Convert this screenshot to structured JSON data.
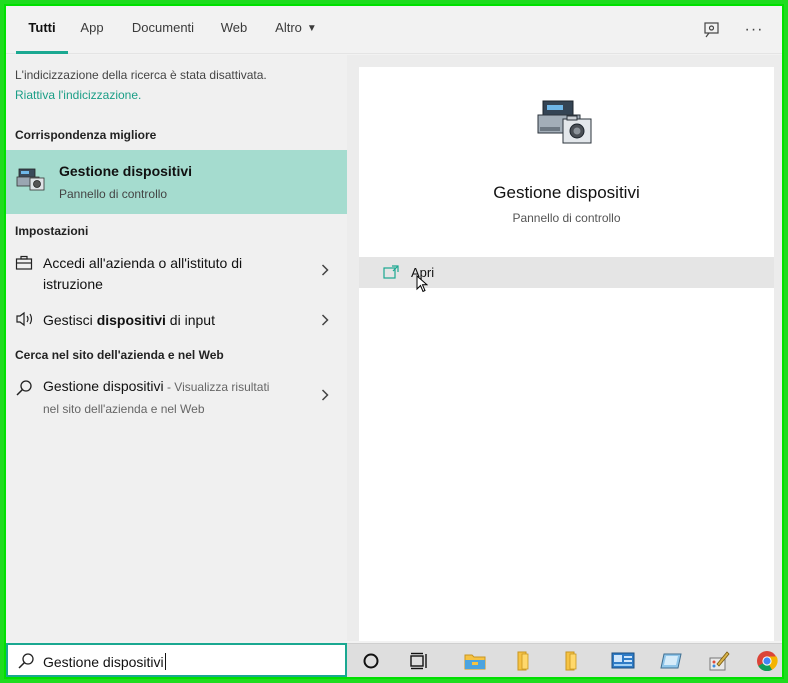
{
  "tabs": [
    {
      "label": "Tutti",
      "active": true
    },
    {
      "label": "App"
    },
    {
      "label": "Documenti"
    },
    {
      "label": "Web"
    },
    {
      "label": "Altro"
    }
  ],
  "notice": {
    "text": "L'indicizzazione della ricerca è stata disattivata.",
    "link": "Riattiva l'indicizzazione."
  },
  "best_match": {
    "heading": "Corrispondenza migliore",
    "title": "Gestione dispositivi",
    "subtitle": "Pannello di controllo"
  },
  "settings": {
    "heading": "Impostazioni",
    "items": [
      {
        "line1": "Accedi all'azienda o all'istituto di",
        "line2": "istruzione"
      },
      {
        "pre": "Gestisci ",
        "bold": "dispositivi",
        "post": " di input"
      }
    ]
  },
  "web": {
    "heading": "Cerca nel sito dell'azienda e nel Web",
    "title": "Gestione dispositivi",
    "suffix": " - Visualizza risultati",
    "line2": "nel sito dell'azienda e nel Web"
  },
  "preview": {
    "title": "Gestione dispositivi",
    "subtitle": "Pannello di controllo",
    "action_open": "Apri"
  },
  "search": {
    "value": "Gestione dispositivi"
  },
  "colors": {
    "accent": "#1aa891",
    "selection": "#a5dccf",
    "frame": "#1fdc1f"
  }
}
